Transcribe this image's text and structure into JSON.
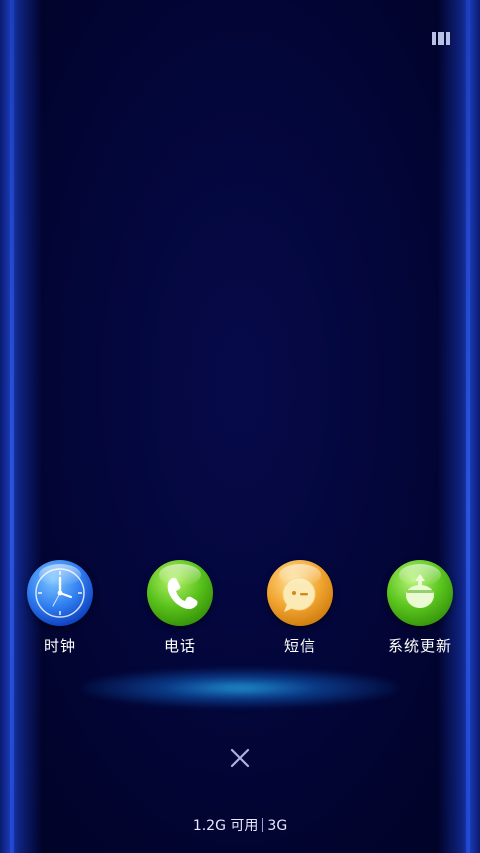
{
  "apps": [
    {
      "label": "时钟",
      "icon": "clock-icon",
      "color": "#2f7df0"
    },
    {
      "label": "电话",
      "icon": "phone-icon",
      "color": "#5ac21c"
    },
    {
      "label": "短信",
      "icon": "message-icon",
      "color": "#f2a632"
    },
    {
      "label": "系统更新",
      "icon": "system-update-icon",
      "color": "#5cc61e"
    }
  ],
  "memory": {
    "available": "1.2G 可用",
    "total": "3G"
  },
  "colors": {
    "background": "#020431",
    "edge_glow": "#1a3bb8"
  }
}
